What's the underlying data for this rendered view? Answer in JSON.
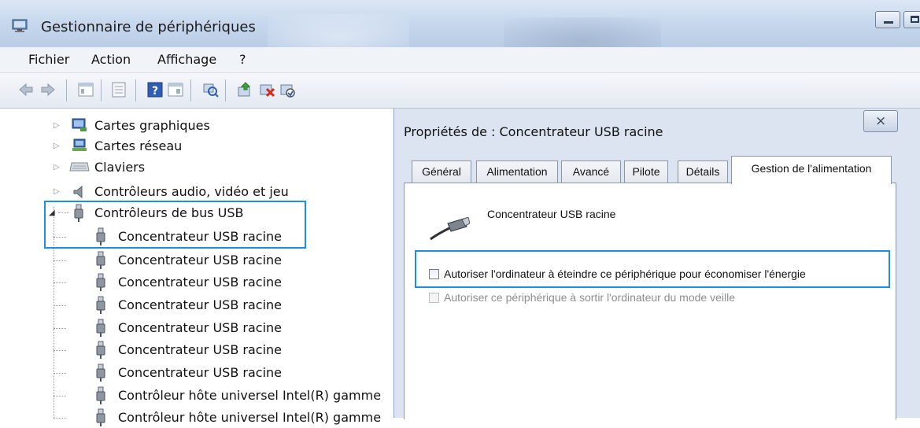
{
  "window": {
    "title": "Gestionnaire de périphériques"
  },
  "menu": {
    "items": [
      "Fichier",
      "Action",
      "Affichage",
      "?"
    ]
  },
  "toolbar": {
    "buttons": [
      "back-arrow-icon",
      "forward-arrow-icon",
      "show-hide-tree-icon",
      "properties-icon",
      "help-icon",
      "view-icon",
      "scan-hardware-icon",
      "update-driver-icon",
      "uninstall-device-icon",
      "disable-device-icon"
    ]
  },
  "tree": {
    "items": [
      {
        "label": "Cartes graphiques",
        "icon": "display-adapter-icon",
        "expander": "▷"
      },
      {
        "label": "Cartes réseau",
        "icon": "network-adapter-icon",
        "expander": "▷"
      },
      {
        "label": "Claviers",
        "icon": "keyboard-icon",
        "expander": "▷"
      },
      {
        "label": "Contrôleurs audio, vidéo et jeu",
        "icon": "speaker-icon",
        "expander": "▷"
      },
      {
        "label": "Contrôleurs de bus USB",
        "icon": "usb-plug-icon",
        "expander": "◢"
      }
    ],
    "usb_children": [
      "Concentrateur USB racine",
      "Concentrateur USB racine",
      "Concentrateur USB racine",
      "Concentrateur USB racine",
      "Concentrateur USB racine",
      "Concentrateur USB racine",
      "Concentrateur USB racine",
      "Contrôleur hôte universel Intel(R) gamme",
      "Contrôleur hôte universel Intel(R) gamme"
    ]
  },
  "dialog": {
    "title": "Propriétés de : Concentrateur USB racine",
    "close_label": "⨯",
    "tabs": [
      "Général",
      "Alimentation",
      "Avancé",
      "Pilote",
      "Détails",
      "Gestion de l'alimentation"
    ],
    "active_tab": "Gestion de l'alimentation",
    "device_name": "Concentrateur USB racine",
    "options": [
      {
        "label": "Autoriser l'ordinateur à éteindre ce périphérique pour économiser l'énergie",
        "checked": false,
        "enabled": true
      },
      {
        "label": "Autoriser ce périphérique à sortir l'ordinateur du mode veille",
        "checked": false,
        "enabled": false
      }
    ]
  },
  "colors": {
    "highlight_box": "#1c8ee8",
    "disabled_text": "#8d8d8d",
    "titlebar": "#c8d9ee"
  }
}
